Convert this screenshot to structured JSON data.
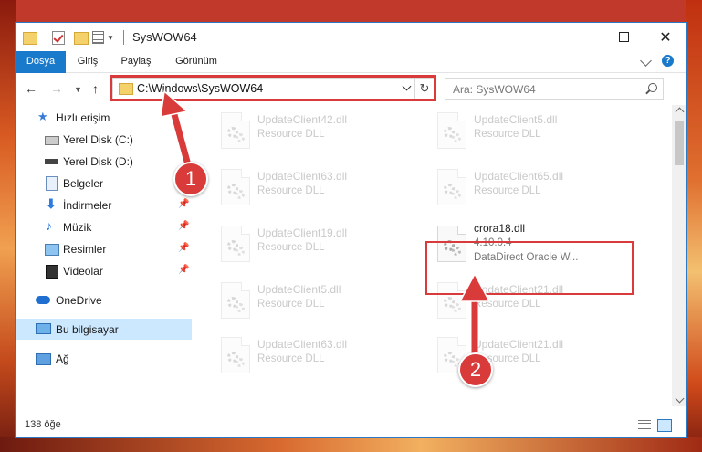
{
  "window": {
    "title": "SysWOW64"
  },
  "ribbon": {
    "tabs": [
      "Dosya",
      "Giriş",
      "Paylaş",
      "Görünüm"
    ]
  },
  "address": {
    "path": "C:\\Windows\\SysWOW64"
  },
  "search": {
    "placeholder": "Ara: SysWOW64"
  },
  "sidebar": {
    "items": [
      {
        "label": "Hızlı erişim"
      },
      {
        "label": "Yerel Disk (C:)"
      },
      {
        "label": "Yerel Disk (D:)"
      },
      {
        "label": "Belgeler"
      },
      {
        "label": "İndirmeler"
      },
      {
        "label": "Müzik"
      },
      {
        "label": "Resimler"
      },
      {
        "label": "Videolar"
      },
      {
        "label": "OneDrive"
      },
      {
        "label": "Bu bilgisayar"
      },
      {
        "label": "Ağ"
      }
    ]
  },
  "files": [
    {
      "name": "UpdateClient42.dll",
      "type": "Resource DLL"
    },
    {
      "name": "UpdateClient5.dll",
      "type": "Resource DLL"
    },
    {
      "name": "UpdateClient63.dll",
      "type": "Resource DLL"
    },
    {
      "name": "UpdateClient65.dll",
      "type": "Resource DLL"
    },
    {
      "name": "UpdateClient19.dll",
      "type": "Resource DLL"
    },
    {
      "name": "crora18.dll",
      "version": "4.10.0.4",
      "desc": "DataDirect Oracle W..."
    },
    {
      "name": "UpdateClient5.dll",
      "type": "Resource DLL"
    },
    {
      "name": "UpdateClient21.dll",
      "type": "Resource DLL"
    },
    {
      "name": "UpdateClient63.dll",
      "type": "Resource DLL"
    },
    {
      "name": "UpdateClient21.dll",
      "type": "Resource DLL"
    }
  ],
  "status": {
    "count": "138 öğe"
  },
  "annotations": {
    "one": "1",
    "two": "2"
  },
  "colors": {
    "accent": "#1979ca",
    "highlight": "#d93a3a",
    "selected": "#cce8ff"
  }
}
